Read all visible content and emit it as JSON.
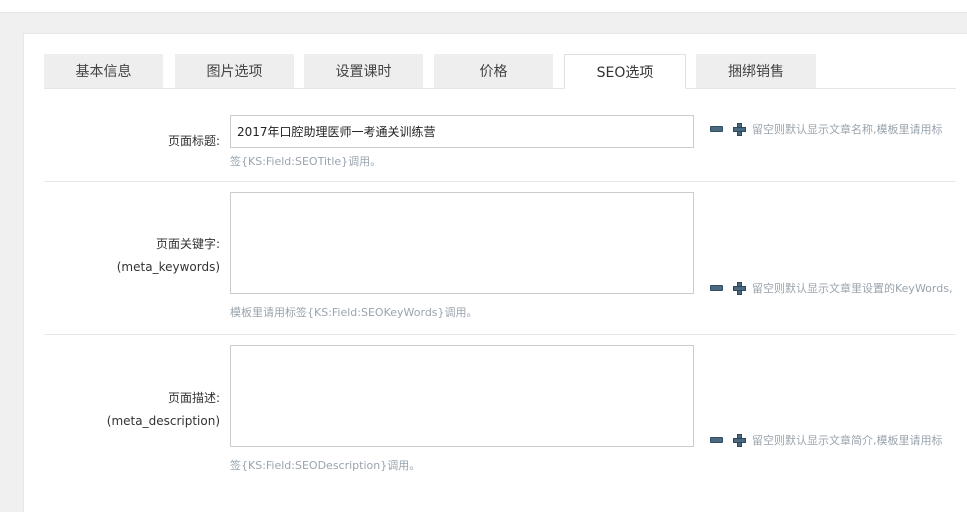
{
  "tabs": [
    "基本信息",
    "图片选项",
    "设置课时",
    "价格",
    "SEO选项",
    "捆绑销售"
  ],
  "active_tab": "SEO选项",
  "seo_title": {
    "label": "页面标题:",
    "value": "2017年口腔助理医师一考通关训练营",
    "hint_side": "留空则默认显示文章名称,模板里请用标",
    "hint_below": "签{KS:Field:SEOTitle}调用。"
  },
  "meta_keywords": {
    "label": "页面关键字:",
    "sublabel": "(meta_keywords)",
    "value": "",
    "hint_side": "留空则默认显示文章里设置的KeyWords,",
    "hint_below": "模板里请用标签{KS:Field:SEOKeyWords}调用。"
  },
  "meta_description": {
    "label": "页面描述:",
    "sublabel": "(meta_description)",
    "value": "",
    "hint_side": "留空则默认显示文章简介,模板里请用标",
    "hint_below": "签{KS:Field:SEODescription}调用。"
  },
  "icons": {
    "minus": "minus-icon",
    "plus": "plus-icon"
  },
  "colors": {
    "hint": "#9aa4ae",
    "icon": "#4a6a82",
    "tab_bg": "#eeeeee"
  }
}
